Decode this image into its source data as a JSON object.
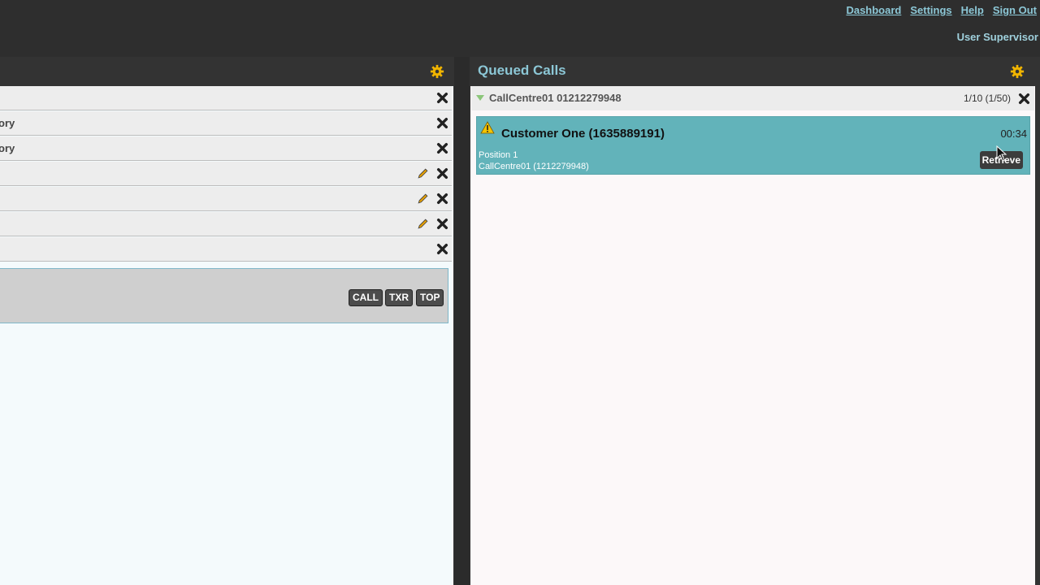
{
  "topnav": {
    "links": [
      "Dashboard",
      "Settings",
      "Help",
      "Sign Out"
    ],
    "user": "User Supervisor"
  },
  "left_panel": {
    "rows": [
      {
        "label": "",
        "edit": false
      },
      {
        "label": "ory",
        "edit": false
      },
      {
        "label": "ory",
        "edit": false
      },
      {
        "label": "",
        "edit": true
      },
      {
        "label": "",
        "edit": true
      },
      {
        "label": "",
        "edit": true
      },
      {
        "label": "",
        "edit": false
      }
    ],
    "call_buttons": [
      "CALL",
      "TXR",
      "TOP"
    ]
  },
  "right_panel": {
    "title": "Queued Calls",
    "group": {
      "name": "CallCentre01 01212279948",
      "count": "1/10 (1/50)"
    },
    "queued_call": {
      "caller": "Customer One (1635889191)",
      "timer": "00:34",
      "position": "Position 1",
      "queue": "CallCentre01 (1212279948)",
      "retrieve_label": "Retrieve"
    }
  },
  "colors": {
    "accent": "#8cc7d6",
    "card": "#62b3ba",
    "gear": "#f0b400"
  }
}
